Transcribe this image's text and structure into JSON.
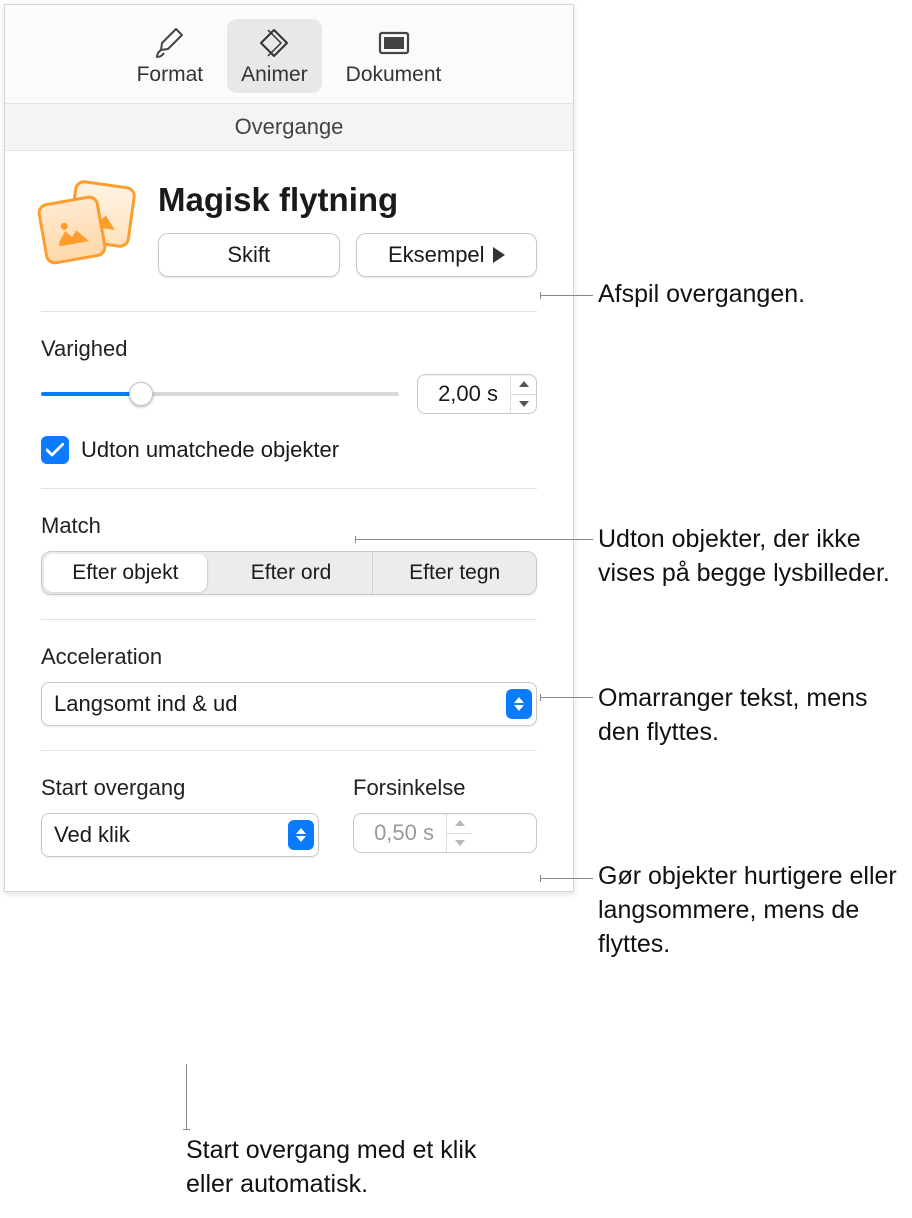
{
  "toolbar": {
    "format": "Format",
    "animate": "Animer",
    "document": "Dokument"
  },
  "section_title": "Overgange",
  "transition_name": "Magisk flytning",
  "buttons": {
    "change": "Skift",
    "preview": "Eksempel"
  },
  "duration": {
    "label": "Varighed",
    "value": "2,00 s",
    "slider_percent": 28
  },
  "fade_unmatched": {
    "label": "Udton umatchede objekter",
    "checked": true
  },
  "match": {
    "label": "Match",
    "options": [
      "Efter objekt",
      "Efter ord",
      "Efter tegn"
    ],
    "selected": 0
  },
  "acceleration": {
    "label": "Acceleration",
    "value": "Langsomt ind & ud"
  },
  "start": {
    "label": "Start overgang",
    "value": "Ved klik"
  },
  "delay": {
    "label": "Forsinkelse",
    "value": "0,50 s"
  },
  "callouts": {
    "preview": "Afspil overgangen.",
    "fade": "Udton objekter, der ikke vises på begge lysbilleder.",
    "match": "Omarranger tekst, mens den flyttes.",
    "accel": "Gør objekter hurtigere eller langsommere, mens de flyttes.",
    "start": "Start overgang med et klik eller automatisk."
  }
}
